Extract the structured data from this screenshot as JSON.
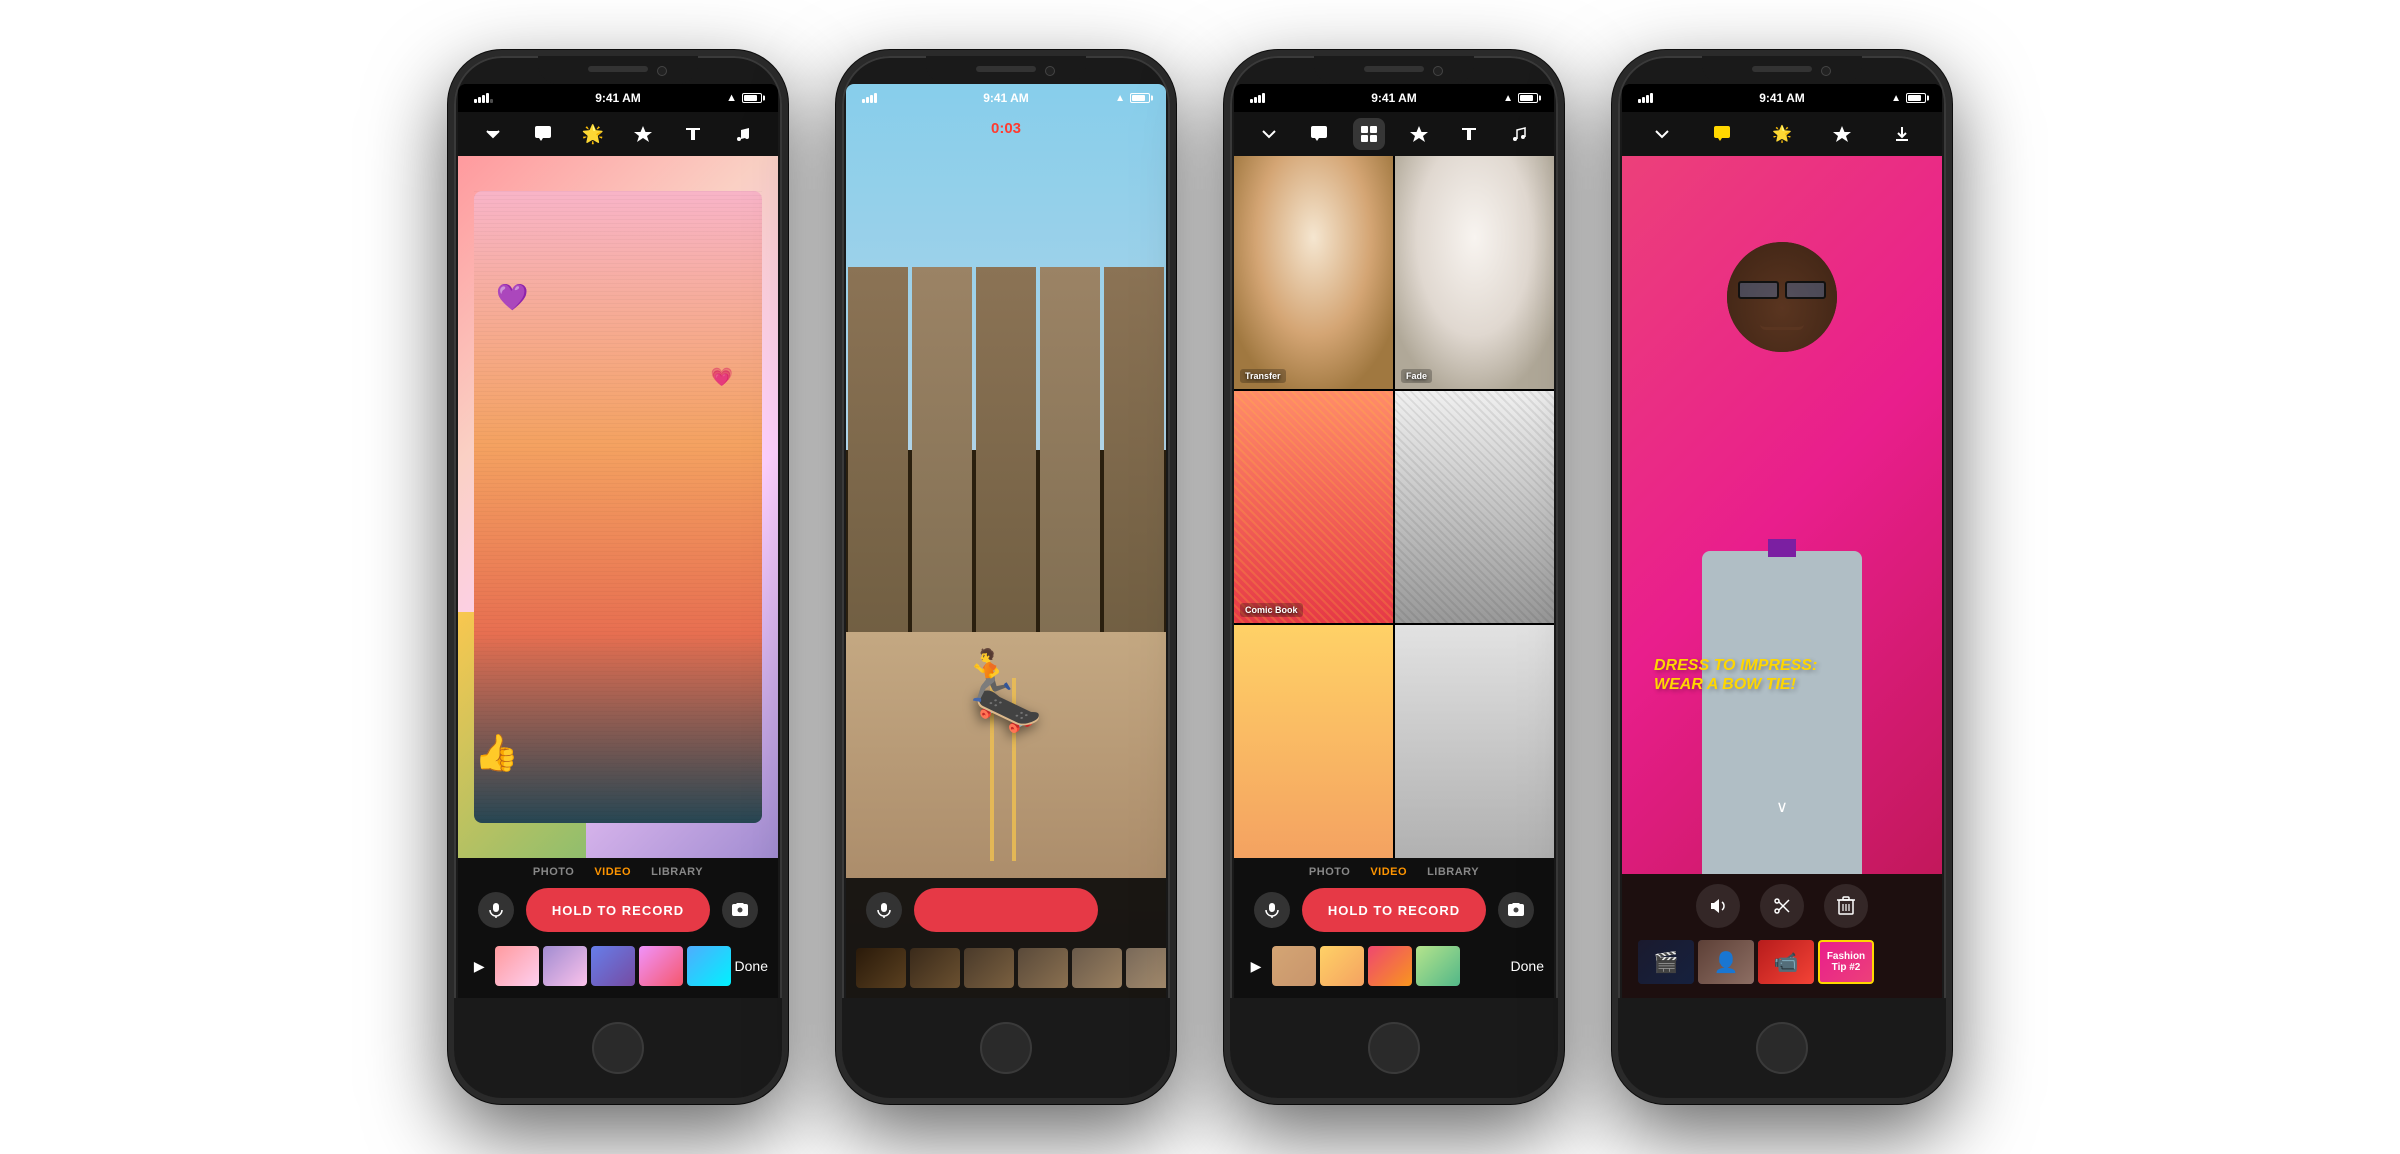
{
  "phones": [
    {
      "id": "phone1",
      "statusBar": {
        "time": "9:41 AM",
        "signal": 4,
        "wifi": true,
        "battery": 80
      },
      "toolbar": {
        "icons": [
          "chevron-down",
          "speech-bubble",
          "heart",
          "star",
          "text",
          "music-note"
        ]
      },
      "mainContent": "cartoon-selfie",
      "overlays": {
        "hearts": [
          "💜",
          "💗"
        ],
        "emoji": "👍"
      },
      "bottomControls": {
        "modeTabs": [
          "PHOTO",
          "VIDEO",
          "LIBRARY"
        ],
        "activeTab": "VIDEO",
        "recordButton": "HOLD TO RECORD",
        "hasMicBtn": true,
        "hasCameraBtn": true,
        "hasDoneBtn": true,
        "hasPlayBtn": true,
        "thumbCount": 5
      }
    },
    {
      "id": "phone2",
      "statusBar": {
        "time": "9:41 AM",
        "signal": 4,
        "wifi": true,
        "battery": 80
      },
      "mainContent": "skater-recording",
      "recordingTimer": "0:03",
      "bottomControls": {
        "isRecording": true,
        "hasMicBtn": true,
        "hasProgressBar": true,
        "thumbCount": 6
      }
    },
    {
      "id": "phone3",
      "statusBar": {
        "time": "9:41 AM",
        "signal": 4,
        "wifi": true,
        "battery": 80
      },
      "toolbar": {
        "icons": [
          "chevron-down",
          "speech-bubble",
          "photo-filter",
          "star",
          "text",
          "music-note"
        ]
      },
      "mainContent": "filter-grid",
      "filters": [
        {
          "label": "Transfer"
        },
        {
          "label": "Fade"
        },
        {
          "label": "Comic Book"
        },
        {
          "label": ""
        },
        {
          "label": ""
        },
        {
          "label": ""
        }
      ],
      "bottomControls": {
        "modeTabs": [
          "PHOTO",
          "VIDEO",
          "LIBRARY"
        ],
        "activeTab": "VIDEO",
        "recordButton": "HOLD TO RECORD",
        "hasMicBtn": true,
        "hasCameraBtn": true,
        "hasDoneBtn": true,
        "hasPlayBtn": true,
        "thumbCount": 4
      }
    },
    {
      "id": "phone4",
      "statusBar": {
        "time": "9:41 AM",
        "signal": 4,
        "wifi": true,
        "battery": 80
      },
      "toolbar": {
        "icons": [
          "chevron-down",
          "speech-bubble",
          "heart",
          "star",
          "download"
        ]
      },
      "mainContent": "man-portrait",
      "overlayText": "DRESS TO IMPRESS:\nWEAR A BOW TIE!",
      "bottomControls": {
        "editButtons": [
          "volume",
          "scissors",
          "trash"
        ],
        "hasTimeline": true,
        "clips": [
          {
            "label": "",
            "selected": false
          },
          {
            "label": "",
            "selected": false
          },
          {
            "label": "",
            "selected": false
          },
          {
            "label": "Fashion Tip #2",
            "selected": true
          }
        ]
      }
    }
  ]
}
